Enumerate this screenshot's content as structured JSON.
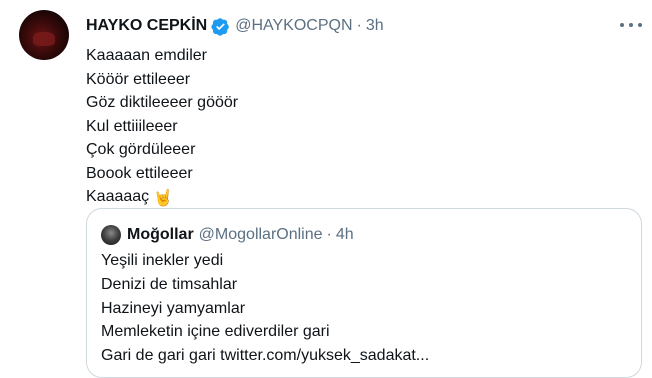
{
  "tweet": {
    "author_name": "HAYKO CEPKİN",
    "handle": "@HAYKOCPQN",
    "separator": "·",
    "time": "3h",
    "lines": [
      "Kaaaaan emdiler",
      "Kööör ettileeer",
      "Göz diktileeeer gööör",
      "Kul ettiiileeer",
      "Çok gördüleeer",
      "Boook ettileeer",
      "Kaaaaaç"
    ],
    "emoji": "🤘"
  },
  "quote": {
    "author_name": "Moğollar",
    "handle": "@MogollarOnline",
    "separator": "·",
    "time": "4h",
    "lines": [
      "Yeşili inekler yedi",
      "Denizi de timsahlar",
      "Hazineyi yamyamlar",
      "Memleketin içine ediverdiler gari",
      "Gari de gari gari twitter.com/yuksek_sadakat..."
    ]
  },
  "colors": {
    "text": "#0f1419",
    "secondary": "#5b7083",
    "verified": "#1d9bf0",
    "border": "#cfd9de"
  },
  "icons": [
    "verified-badge-icon",
    "more-options-icon",
    "sign-of-horns-emoji"
  ]
}
